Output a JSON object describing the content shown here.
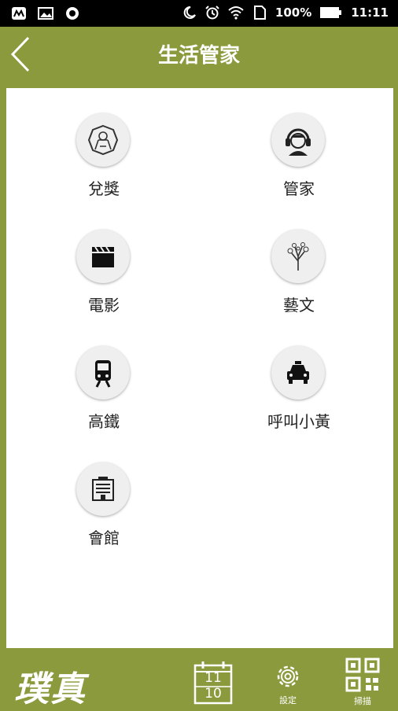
{
  "status_bar": {
    "battery": "100%",
    "time": "11:11"
  },
  "header": {
    "title": "生活管家"
  },
  "items": [
    {
      "label": "兌獎",
      "icon": "lottery-icon"
    },
    {
      "label": "管家",
      "icon": "headset-agent-icon"
    },
    {
      "label": "電影",
      "icon": "clapperboard-icon"
    },
    {
      "label": "藝文",
      "icon": "tree-icon"
    },
    {
      "label": "高鐵",
      "icon": "train-icon"
    },
    {
      "label": "呼叫小黃",
      "icon": "taxi-icon"
    },
    {
      "label": "會館",
      "icon": "building-icon"
    }
  ],
  "bottom_bar": {
    "logo": "璞真",
    "calendar_month": "11",
    "calendar_day": "10",
    "settings_label": "設定",
    "scan_label": "掃描"
  },
  "colors": {
    "accent": "#8a9a3c",
    "panel": "#ffffff"
  }
}
